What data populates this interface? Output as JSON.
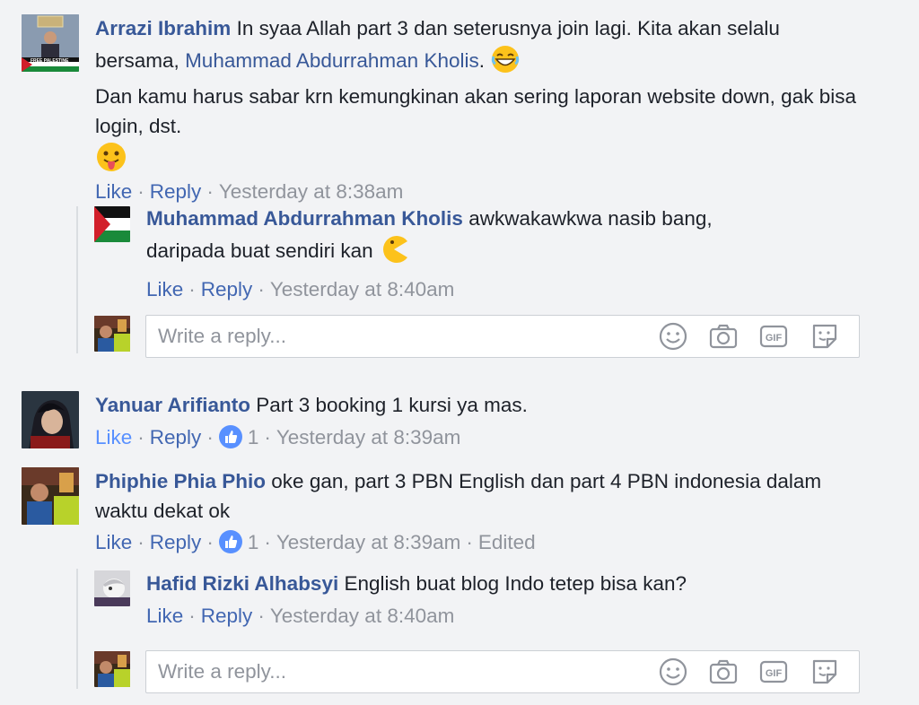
{
  "actions": {
    "like": "Like",
    "reply": "Reply",
    "separator": "·"
  },
  "reply_box": {
    "placeholder": "Write a reply..."
  },
  "comments": [
    {
      "author": "Arrazi Ibrahim",
      "avatar_caption": "FREE PALESTINE",
      "text_before": "In syaa Allah part 3 dan seterusnya join lagi. Kita akan selalu bersama,",
      "mention": "Muhammad Abdurrahman Kholis",
      "text_after": ".",
      "text_line2": "Dan kamu harus sabar krn kemungkinan akan sering laporan website down, gak bisa login, dst.",
      "emoji_1": "grinning-sweat-emoji",
      "emoji_2": "tongue-out-emoji",
      "time": "Yesterday at 8:38am",
      "replies": [
        {
          "author": "Muhammad Abdurrahman Kholis",
          "text": "awkwakawkwa nasib bang, daripada buat sendiri kan",
          "emoji": "pacman-emoji",
          "time": "Yesterday at 8:40am"
        }
      ]
    },
    {
      "author": "Yanuar Arifianto",
      "text": "Part 3 booking 1 kursi ya mas.",
      "like_count": "1",
      "liked": true,
      "time": "Yesterday at 8:39am"
    },
    {
      "author": "Phiphie Phia Phio",
      "text": "oke gan, part 3 PBN English dan part 4 PBN indonesia dalam waktu dekat ok",
      "like_count": "1",
      "time": "Yesterday at 8:39am",
      "edited": "Edited",
      "replies": [
        {
          "author": "Hafid Rizki Alhabsyi",
          "text": "English buat blog Indo tetep bisa kan?",
          "time": "Yesterday at 8:40am"
        }
      ]
    }
  ],
  "colors": {
    "author": "#385898",
    "link": "#4267b2",
    "meta": "#90949c",
    "like_blue": "#5890ff",
    "background": "#f2f3f5"
  },
  "icons": {
    "composer": [
      "smiley-icon",
      "camera-icon",
      "gif-icon",
      "sticker-icon"
    ]
  }
}
